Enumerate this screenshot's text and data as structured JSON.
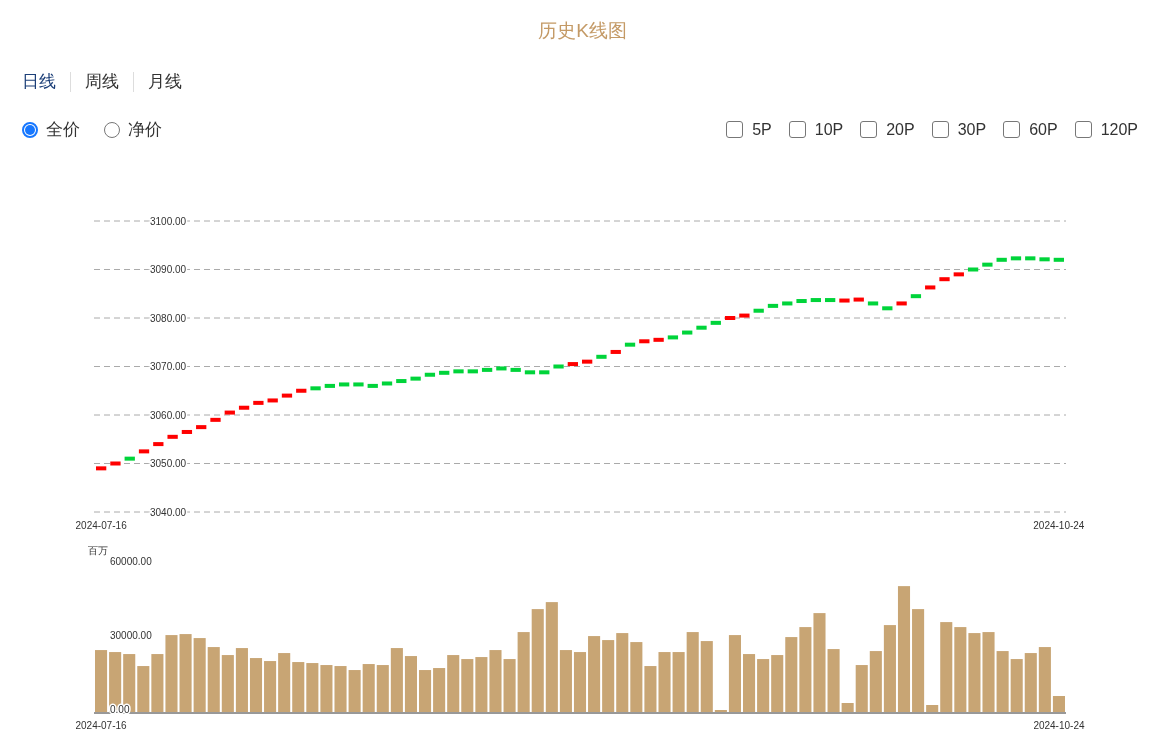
{
  "title": "历史K线图",
  "tabs": [
    {
      "label": "日线",
      "selected": true
    },
    {
      "label": "周线",
      "selected": false
    },
    {
      "label": "月线",
      "selected": false
    }
  ],
  "price_types": [
    {
      "label": "全价",
      "selected": true
    },
    {
      "label": "净价",
      "selected": false
    }
  ],
  "averages": [
    {
      "label": "5P",
      "checked": false
    },
    {
      "label": "10P",
      "checked": false
    },
    {
      "label": "20P",
      "checked": false
    },
    {
      "label": "30P",
      "checked": false
    },
    {
      "label": "60P",
      "checked": false
    },
    {
      "label": "120P",
      "checked": false
    }
  ],
  "kline": {
    "chart_data": {
      "type": "scatter",
      "grid": true,
      "ylim": [
        3040,
        3100
      ],
      "categories": [
        "2024-07-16",
        null,
        null,
        null,
        null,
        null,
        null,
        null,
        null,
        null,
        null,
        null,
        null,
        null,
        null,
        null,
        null,
        null,
        null,
        null,
        null,
        null,
        null,
        null,
        null,
        null,
        null,
        null,
        null,
        null,
        null,
        null,
        null,
        null,
        null,
        null,
        null,
        null,
        null,
        null,
        null,
        null,
        null,
        null,
        null,
        null,
        null,
        null,
        null,
        null,
        null,
        null,
        null,
        null,
        null,
        null,
        null,
        null,
        null,
        null,
        null,
        null,
        null,
        null,
        null,
        null,
        null,
        "2024-10-24"
      ],
      "yticks": [
        {
          "value": 3040,
          "label": "3040.00"
        },
        {
          "value": 3050,
          "label": "3050.00"
        },
        {
          "value": 3060,
          "label": "3060.00"
        },
        {
          "value": 3070,
          "label": "3070.00"
        },
        {
          "value": 3080,
          "label": "3080.00"
        },
        {
          "value": 3090,
          "label": "3090.00"
        },
        {
          "value": 3100,
          "label": "3100.00"
        }
      ],
      "series": [
        {
          "color": "#ff0000",
          "values": [
            3049,
            3050,
            null,
            3052.5,
            3054,
            3055.5,
            3056.5,
            3057.5,
            3059,
            3060.5,
            3061.5,
            3062.5,
            3063,
            3064,
            3065,
            null,
            null,
            null,
            null,
            null,
            null,
            null,
            null,
            null,
            null,
            null,
            null,
            null,
            null,
            null,
            null,
            null,
            null,
            3070.5,
            3071,
            null,
            3073,
            null,
            3075.2,
            3075.5,
            null,
            null,
            null,
            null,
            3080,
            3080.5,
            null,
            null,
            null,
            null,
            null,
            null,
            3083.6,
            3083.8,
            null,
            null,
            3083,
            null,
            3086.3,
            3088,
            3089,
            null,
            null,
            null,
            null,
            null,
            null,
            null
          ]
        },
        {
          "color": "#00d43a",
          "values": [
            null,
            null,
            3051,
            null,
            null,
            null,
            null,
            null,
            null,
            null,
            null,
            null,
            null,
            null,
            null,
            3065.5,
            3066,
            3066.3,
            3066.3,
            3066,
            3066.5,
            3067,
            3067.5,
            3068.3,
            3068.7,
            3069,
            3069,
            3069.3,
            3069.6,
            3069.3,
            3068.8,
            3068.8,
            3070,
            null,
            null,
            3072,
            null,
            3074.5,
            null,
            null,
            3076,
            3077,
            3078,
            3079,
            null,
            null,
            3081.5,
            3082.5,
            3083,
            3083.5,
            3083.7,
            3083.7,
            null,
            null,
            3083,
            3082,
            null,
            3084.5,
            null,
            null,
            null,
            3090,
            3091,
            3092,
            3092.3,
            3092.3,
            3092.1,
            3092
          ]
        }
      ]
    }
  },
  "volume": {
    "chart_data": {
      "type": "bar",
      "grid": false,
      "ylabel": "百万",
      "ylim": [
        0,
        60000
      ],
      "yticks": [
        {
          "value": 0,
          "label": "0.00"
        },
        {
          "value": 30000,
          "label": "30000.00"
        },
        {
          "value": 60000,
          "label": "60000.00"
        }
      ],
      "categories": [
        "2024-07-16",
        null,
        null,
        null,
        null,
        null,
        null,
        null,
        null,
        null,
        null,
        null,
        null,
        null,
        null,
        null,
        null,
        null,
        null,
        null,
        null,
        null,
        null,
        null,
        null,
        null,
        null,
        null,
        null,
        null,
        null,
        null,
        null,
        null,
        null,
        null,
        null,
        null,
        null,
        null,
        null,
        null,
        null,
        null,
        null,
        null,
        null,
        null,
        null,
        null,
        null,
        null,
        null,
        null,
        null,
        null,
        null,
        null,
        null,
        null,
        null,
        null,
        null,
        null,
        null,
        null,
        null,
        null,
        "2024-10-24"
      ],
      "values": [
        25110,
        24300,
        23490,
        18630,
        23490,
        31185,
        31590,
        29970,
        26325,
        23085,
        25920,
        21870,
        20655,
        23895,
        20250,
        19845,
        19035,
        18630,
        17010,
        19440,
        19035,
        25920,
        22680,
        17010,
        17820,
        23085,
        21465,
        22275,
        25110,
        21465,
        32400,
        41715,
        44550,
        25110,
        24300,
        30780,
        29160,
        31995,
        28350,
        18630,
        24300,
        24300,
        32400,
        28755,
        810,
        31185,
        23490,
        21465,
        23085,
        30375,
        34425,
        40095,
        25515,
        3645,
        19035,
        24705,
        35235,
        51030,
        41715,
        2835,
        36450,
        34425,
        31995,
        32400,
        24705,
        21465,
        23895,
        26325,
        6480
      ]
    }
  }
}
